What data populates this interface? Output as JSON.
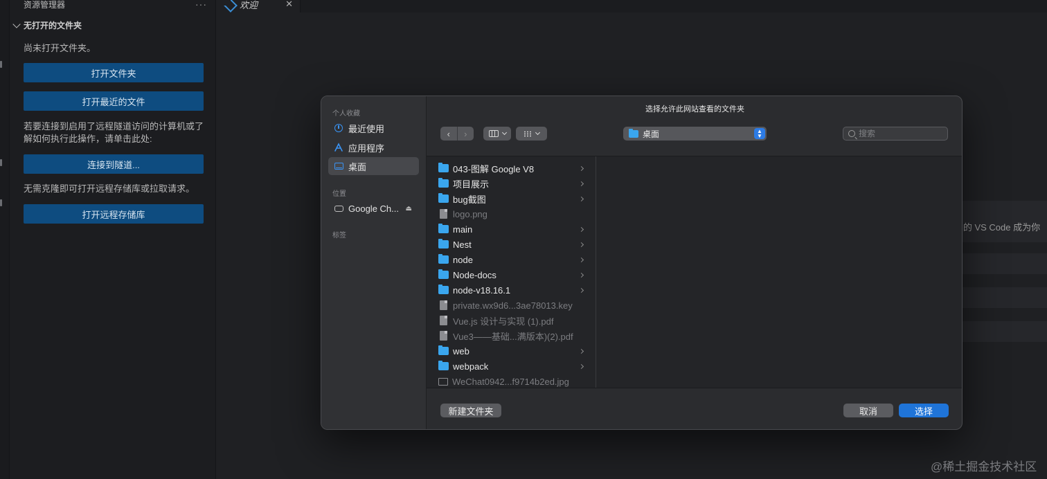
{
  "sidebar": {
    "title": "资源管理器",
    "more": "···",
    "section": "无打开的文件夹",
    "no_folder_text": "尚未打开文件夹。",
    "open_folder": "打开文件夹",
    "open_recent": "打开最近的文件",
    "tunnel_text_1": "若要连接到启用了远程隧道访问的计算机或了",
    "tunnel_text_2": "解如何执行此操作，请单击此处:",
    "connect_tunnel": "连接到隧道...",
    "repo_text": "无需克隆即可打开远程存储库或拉取请求。",
    "open_remote_repo": "打开远程存储库"
  },
  "editor": {
    "tab_label": "欢迎",
    "tab_close": "✕",
    "welcome_snippet": "b 的 VS Code 成为你"
  },
  "watermark": "@稀土掘金技术社区",
  "dialog": {
    "title": "选择允许此网站查看的文件夹",
    "sidebar": {
      "favorites_header": "个人收藏",
      "favorites": [
        {
          "label": "最近使用",
          "icon": "clock-icon"
        },
        {
          "label": "应用程序",
          "icon": "apps-icon"
        },
        {
          "label": "桌面",
          "icon": "desktop-icon",
          "selected": true
        }
      ],
      "locations_header": "位置",
      "locations": [
        {
          "label": "Google Ch...",
          "icon": "drive-icon"
        }
      ],
      "tags_header": "标签"
    },
    "toolbar": {
      "back": "‹",
      "forward": "›",
      "location": "桌面",
      "search_placeholder": "搜索"
    },
    "files": [
      {
        "name": "043-图解 Google V8",
        "type": "folder"
      },
      {
        "name": "项目展示",
        "type": "folder"
      },
      {
        "name": "bug截图",
        "type": "folder"
      },
      {
        "name": "logo.png",
        "type": "image",
        "disabled": true
      },
      {
        "name": "main",
        "type": "folder"
      },
      {
        "name": "Nest",
        "type": "folder"
      },
      {
        "name": "node",
        "type": "folder"
      },
      {
        "name": "Node-docs",
        "type": "folder"
      },
      {
        "name": "node-v18.16.1",
        "type": "folder"
      },
      {
        "name": "private.wx9d6...3ae78013.key",
        "type": "file",
        "disabled": true
      },
      {
        "name": "Vue.js 设计与实现 (1).pdf",
        "type": "file",
        "disabled": true
      },
      {
        "name": "Vue3——基础...满版本)(2).pdf",
        "type": "file",
        "disabled": true
      },
      {
        "name": "web",
        "type": "folder"
      },
      {
        "name": "webpack",
        "type": "folder"
      },
      {
        "name": "WeChat0942...f9714b2ed.jpg",
        "type": "image",
        "disabled": true
      }
    ],
    "buttons": {
      "new_folder": "新建文件夹",
      "cancel": "取消",
      "choose": "选择"
    }
  }
}
